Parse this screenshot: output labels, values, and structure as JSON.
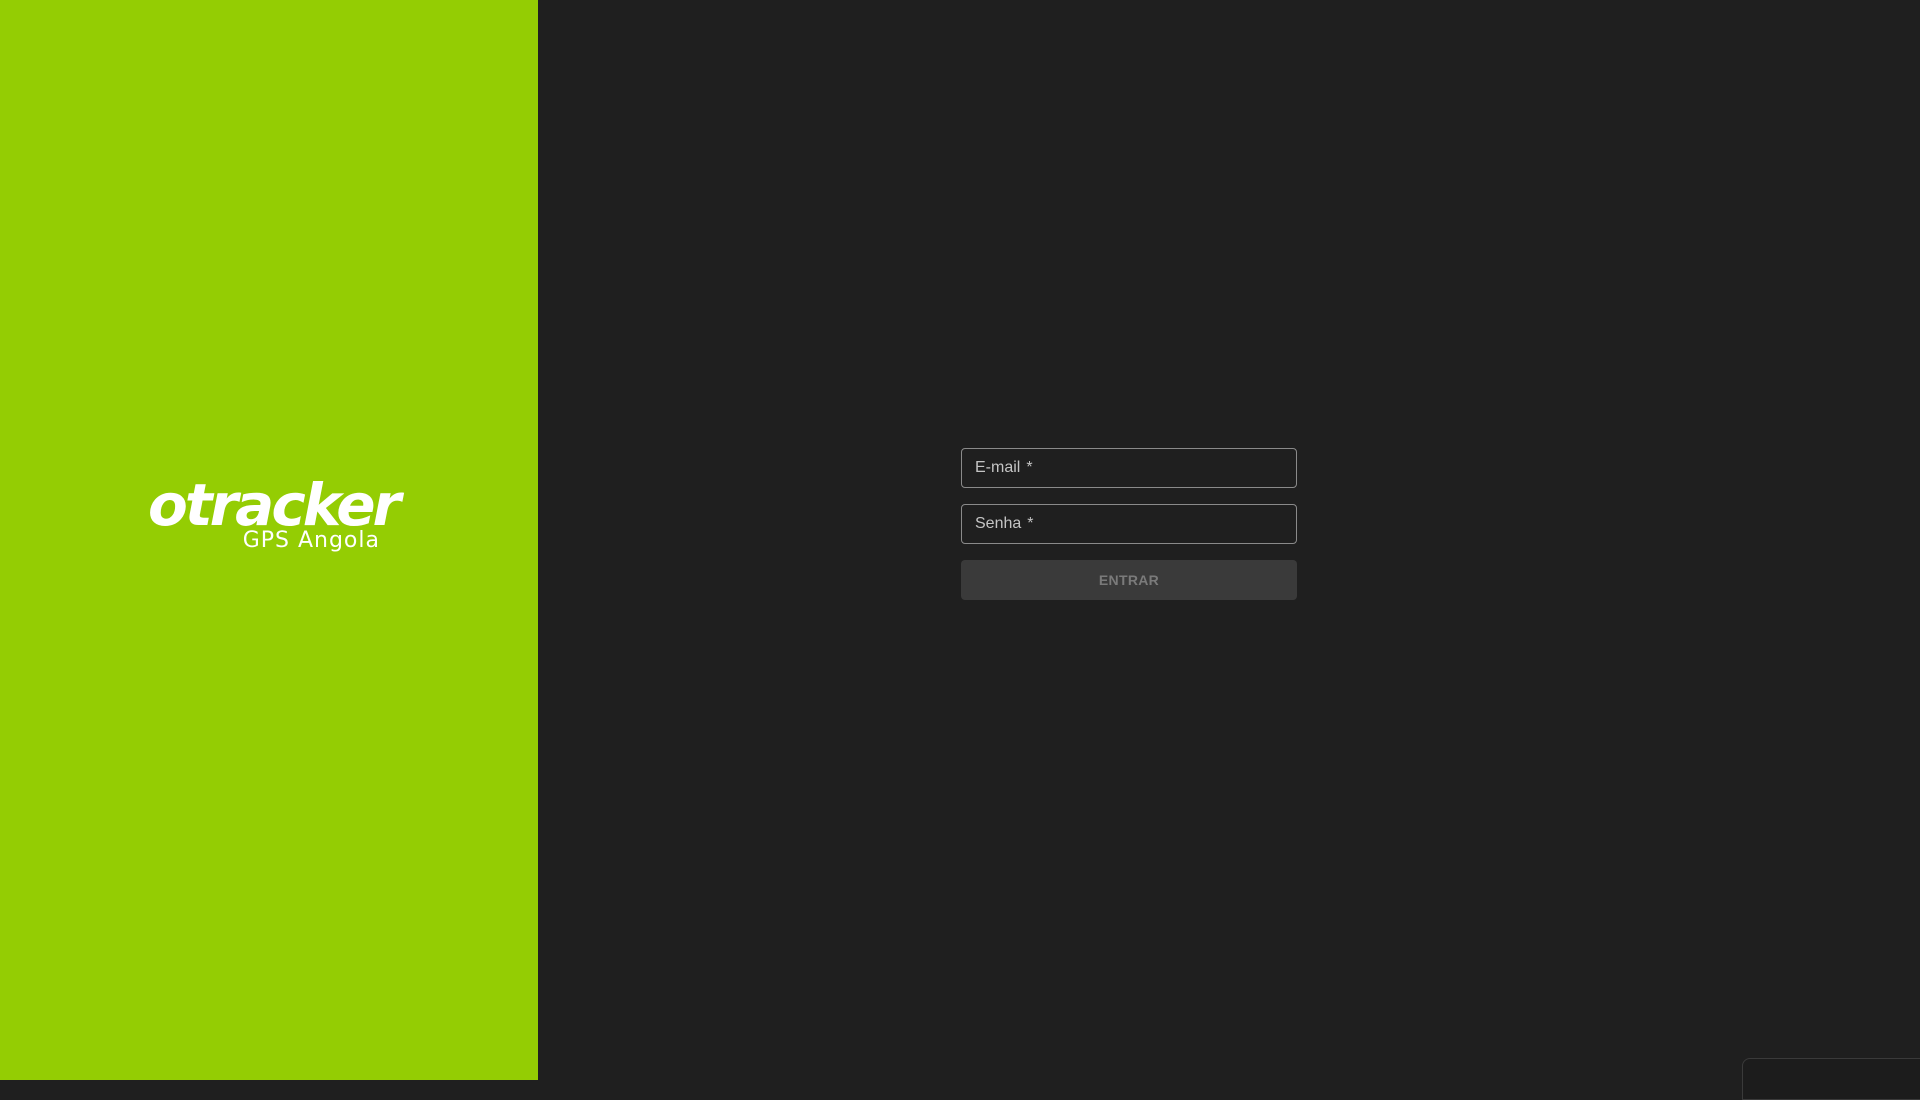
{
  "brand": {
    "logo_word": "otracker",
    "logo_subtitle": "GPS Angola",
    "accent_color": "#94cd03"
  },
  "login": {
    "email_label": "E-mail",
    "password_label": "Senha",
    "required_mark": "*",
    "submit_label": "ENTRAR"
  }
}
